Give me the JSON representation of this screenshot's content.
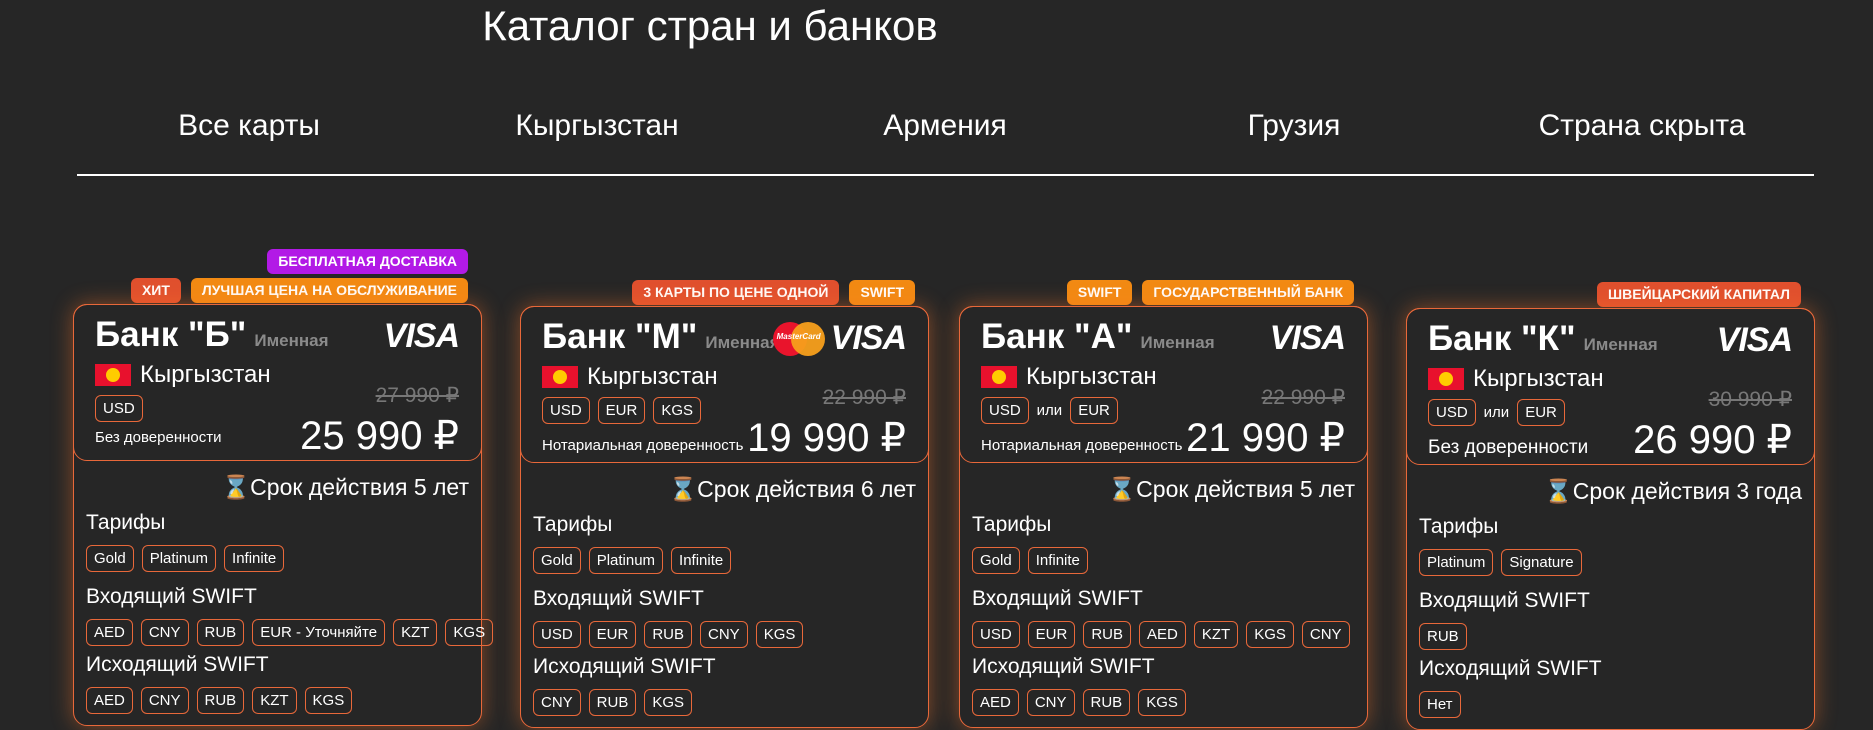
{
  "page_title": "Каталог стран и банков",
  "tabs": [
    "Все карты",
    "Кыргызстан",
    "Армения",
    "Грузия",
    "Страна скрыта"
  ],
  "labels": {
    "tariffs": "Тарифы",
    "incoming_swift": "Входящий SWIFT",
    "outgoing_swift": "Исходящий SWIFT",
    "or": "или"
  },
  "cards": [
    {
      "badges_top": [
        "БЕСПЛАТНАЯ ДОСТАВКА"
      ],
      "badges": [
        "ХИТ",
        "ЛУЧШАЯ ЦЕНА НА ОБСЛУЖИВАНИЕ"
      ],
      "bank": "Банк \"Б\"",
      "named": "Именная",
      "logos": [
        "visa-logo"
      ],
      "country": "Кыргызстан",
      "currencies": [
        "USD"
      ],
      "old_price": "27 990 ₽",
      "price": "25 990 ₽",
      "proxy": "Без доверенности",
      "validity": "⌛Срок действия 5 лет",
      "tariffs": [
        "Gold",
        "Platinum",
        "Infinite"
      ],
      "incoming": [
        "AED",
        "CNY",
        "RUB",
        "EUR - Уточняйте",
        "KZT",
        "KGS"
      ],
      "outgoing": [
        "AED",
        "CNY",
        "RUB",
        "KZT",
        "KGS"
      ]
    },
    {
      "badges_top": [],
      "badges": [
        "3 КАРТЫ ПО ЦЕНЕ ОДНОЙ",
        "SWIFT"
      ],
      "bank": "Банк \"М\"",
      "named": "Именная",
      "logos": [
        "mastercard-logo",
        "visa-logo"
      ],
      "country": "Кыргызстан",
      "currencies": [
        "USD",
        "EUR",
        "KGS"
      ],
      "old_price": "22 990 ₽",
      "price": "19 990 ₽",
      "proxy": "Нотариальная доверенность",
      "validity": "⌛Срок действия 6 лет",
      "tariffs": [
        "Gold",
        "Platinum",
        "Infinite"
      ],
      "incoming": [
        "USD",
        "EUR",
        "RUB",
        "CNY",
        "KGS"
      ],
      "outgoing": [
        "CNY",
        "RUB",
        "KGS"
      ]
    },
    {
      "badges_top": [],
      "badges": [
        "SWIFT",
        "ГОСУДАРСТВЕННЫЙ БАНК"
      ],
      "bank": "Банк \"А\"",
      "named": "Именная",
      "logos": [
        "visa-logo"
      ],
      "country": "Кыргызстан",
      "currencies": [
        "USD",
        "EUR"
      ],
      "old_price": "22 990 ₽",
      "price": "21 990 ₽",
      "proxy": "Нотариальная доверенность",
      "validity": "⌛Срок действия 5 лет",
      "tariffs": [
        "Gold",
        "Infinite"
      ],
      "incoming": [
        "USD",
        "EUR",
        "RUB",
        "AED",
        "KZT",
        "KGS",
        "CNY"
      ],
      "outgoing": [
        "AED",
        "CNY",
        "RUB",
        "KGS"
      ]
    },
    {
      "badges_top": [],
      "badges": [
        "ШВЕЙЦАРСКИЙ КАПИТАЛ"
      ],
      "bank": "Банк \"К\"",
      "named": "Именная",
      "logos": [
        "visa-logo"
      ],
      "country": "Кыргызстан",
      "currencies": [
        "USD",
        "EUR"
      ],
      "old_price": "30 990 ₽",
      "price": "26 990 ₽",
      "proxy": "Без доверенности",
      "validity": "⌛Срок действия 3 года",
      "tariffs": [
        "Platinum",
        "Signature"
      ],
      "incoming": [
        "RUB"
      ],
      "outgoing": [
        "Нет"
      ]
    }
  ],
  "colors": {
    "background": "#262626",
    "accent_border": "#e8683a",
    "badge_red": "#e0502e",
    "badge_orange": "#f28a13",
    "badge_purple": "#b21ae6"
  }
}
